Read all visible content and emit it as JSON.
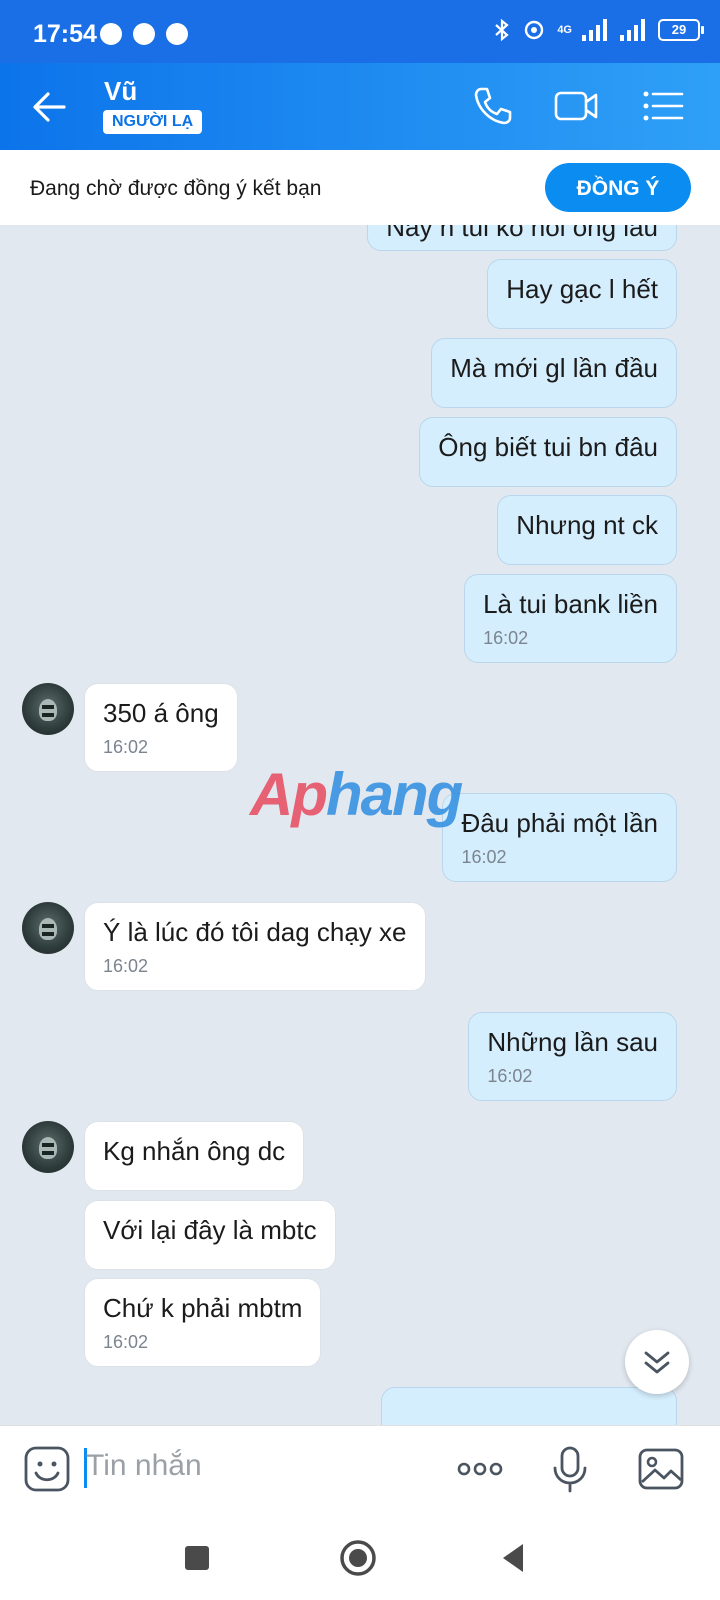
{
  "status_bar": {
    "time": "17:54",
    "network": "4G",
    "battery": "29"
  },
  "header": {
    "contact_name": "Vũ",
    "badge": "NGƯỜI LẠ",
    "icons": [
      "back-arrow-icon",
      "phone-icon",
      "video-call-icon",
      "menu-list-icon"
    ]
  },
  "friend_request": {
    "text": "Đang chờ được đồng ý kết bạn",
    "button": "ĐỒNG Ý"
  },
  "messages": [
    {
      "dir": "out",
      "text": "Nãy h tui ko hỏi ông lầu"
    },
    {
      "dir": "out",
      "text": "Hay gạc l hết"
    },
    {
      "dir": "out",
      "text": "Mà mới gl lần đầu"
    },
    {
      "dir": "out",
      "text": "Ông biết tui bn đâu"
    },
    {
      "dir": "out",
      "text": "Nhưng nt ck"
    },
    {
      "dir": "out",
      "text": "Là tui bank liền",
      "time": "16:02"
    },
    {
      "dir": "in",
      "text": "350 á ông",
      "time": "16:02"
    },
    {
      "dir": "out",
      "text": "Đâu phải một lần",
      "time": "16:02"
    },
    {
      "dir": "in",
      "text": "Ý là lúc đó tôi dag chạy xe",
      "time": "16:02"
    },
    {
      "dir": "out",
      "text": "Những lần sau",
      "time": "16:02"
    },
    {
      "dir": "in",
      "text": "Kg nhắn ông dc"
    },
    {
      "dir": "in",
      "text": "Với lại đây là mbtc"
    },
    {
      "dir": "in",
      "text": "Chứ k phải mbtm",
      "time": "16:02"
    }
  ],
  "watermark": {
    "part1": "Ap",
    "part2": "hang"
  },
  "input": {
    "placeholder": "Tin nhắn"
  },
  "colors": {
    "header_start": "#0c74ea",
    "header_end": "#2fa0f7",
    "outgoing_bubble": "#d5eefd",
    "incoming_bubble": "#ffffff",
    "chat_background": "#e2e8f0",
    "accent": "#0b8cf0"
  }
}
